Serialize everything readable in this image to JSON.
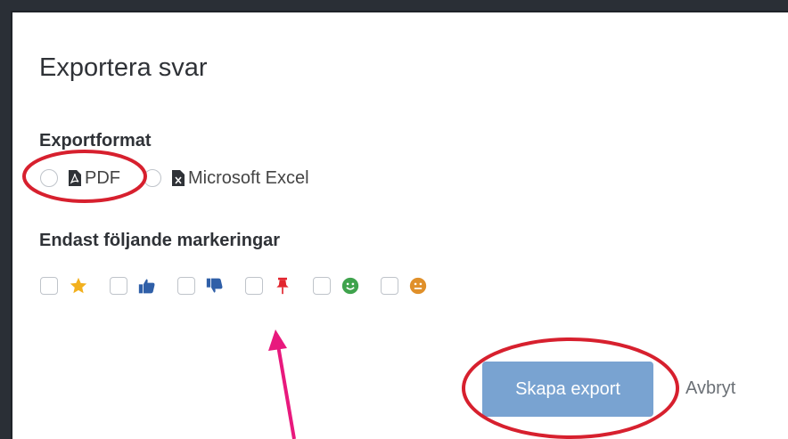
{
  "dialog": {
    "title": "Exportera svar",
    "format_section": {
      "label": "Exportformat",
      "options": [
        {
          "label": "PDF",
          "icon": "file-pdf-icon",
          "selected": false
        },
        {
          "label": "Microsoft Excel",
          "icon": "file-excel-icon",
          "selected": false
        }
      ]
    },
    "markings_section": {
      "label": "Endast följande markeringar",
      "items": [
        {
          "icon": "star-icon",
          "color": "#f2b01e",
          "checked": false
        },
        {
          "icon": "thumbs-up-icon",
          "color": "#2f5fa8",
          "checked": false
        },
        {
          "icon": "thumbs-down-icon",
          "color": "#2f5fa8",
          "checked": false
        },
        {
          "icon": "pin-icon",
          "color": "#e2262f",
          "checked": false
        },
        {
          "icon": "smile-icon",
          "color": "#3fa34d",
          "checked": false
        },
        {
          "icon": "neutral-face-icon",
          "color": "#e0902a",
          "checked": false
        }
      ]
    },
    "buttons": {
      "create_label": "Skapa export",
      "cancel_label": "Avbryt"
    }
  },
  "colors": {
    "primary_button": "#79a3d1",
    "annotation_circle": "#d7202e",
    "annotation_arrow": "#e8197d"
  }
}
